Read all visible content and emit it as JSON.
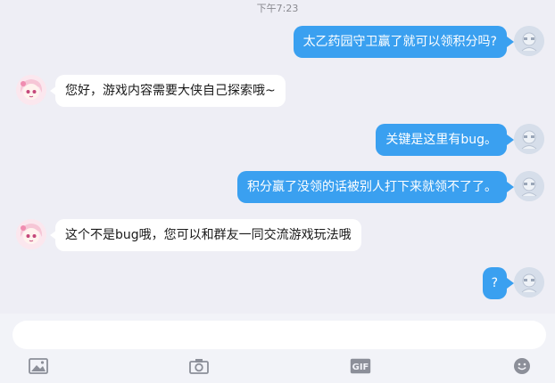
{
  "timestamp": "下午7:23",
  "messages": [
    {
      "side": "out",
      "text": "太乙药园守卫赢了就可以领积分吗?"
    },
    {
      "side": "in",
      "text": "您好，游戏内容需要大侠自己探索哦~"
    },
    {
      "side": "out",
      "text": "关键是这里有bug。"
    },
    {
      "side": "out",
      "text": "积分赢了没领的话被别人打下来就领不了了。"
    },
    {
      "side": "in",
      "text": "这个不是bug哦，您可以和群友一同交流游戏玩法哦"
    },
    {
      "side": "out",
      "text": "?"
    }
  ],
  "composer": {
    "placeholder": ""
  },
  "toolbar": {
    "icons": [
      "image-icon",
      "camera-icon",
      "gif-icon",
      "emoji-icon"
    ],
    "gif_label": "GIF"
  },
  "colors": {
    "background": "#eeeef5",
    "outgoing_bubble": "#3aa0f0",
    "incoming_bubble": "#ffffff"
  }
}
